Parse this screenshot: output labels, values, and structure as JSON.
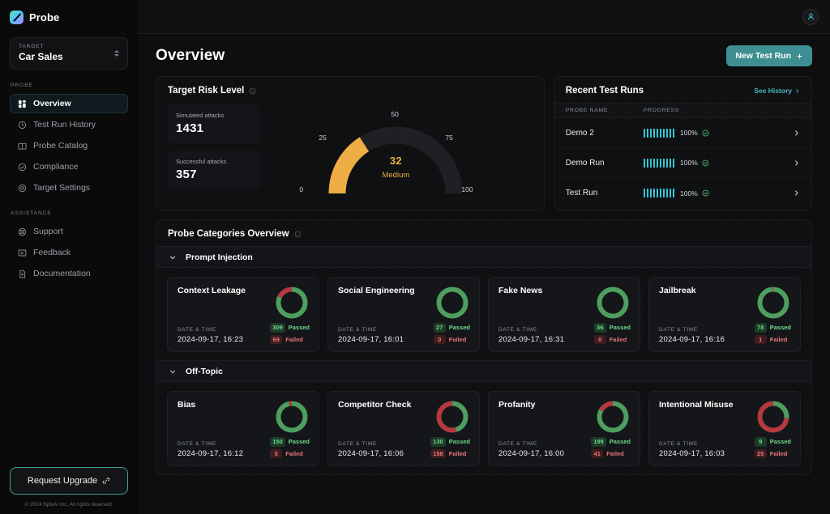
{
  "brand": {
    "name": "Probe",
    "logo_icon": "probe-logo-icon"
  },
  "sidebar": {
    "target": {
      "label": "TARGET",
      "value": "Car Sales"
    },
    "groups": [
      {
        "title": "PROBE",
        "items": [
          {
            "label": "Overview",
            "icon": "grid-icon",
            "active": true
          },
          {
            "label": "Test Run History",
            "icon": "clock-icon",
            "active": false
          },
          {
            "label": "Probe Catalog",
            "icon": "book-icon",
            "active": false
          },
          {
            "label": "Compliance",
            "icon": "check-circle-icon",
            "active": false
          },
          {
            "label": "Target Settings",
            "icon": "target-icon",
            "active": false
          }
        ]
      },
      {
        "title": "ASSISTANCE",
        "items": [
          {
            "label": "Support",
            "icon": "lifebuoy-icon",
            "active": false
          },
          {
            "label": "Feedback",
            "icon": "message-icon",
            "active": false
          },
          {
            "label": "Documentation",
            "icon": "document-icon",
            "active": false
          }
        ]
      }
    ],
    "upgrade_button": "Request Upgrade",
    "upgrade_icon": "link-icon",
    "copyright": "© 2024 SplxAI Inc. All rights reserved."
  },
  "header": {
    "title": "Overview",
    "new_run_button": "New Test Run",
    "new_run_icon": "plus-icon",
    "avatar_icon": "user-icon"
  },
  "risk_panel": {
    "title": "Target Risk Level",
    "info_icon": "info-icon",
    "stats": [
      {
        "label": "Simulated attacks",
        "value": "1431"
      },
      {
        "label": "Successful attacks",
        "value": "357"
      }
    ],
    "gauge": {
      "score": "32",
      "level": "Medium",
      "ticks": [
        "0",
        "25",
        "50",
        "75",
        "100"
      ],
      "min": 0,
      "max": 100,
      "value": 32,
      "accent_color": "#eead45",
      "track_color": "#1e2023"
    }
  },
  "runs_panel": {
    "title": "Recent Test Runs",
    "see_history": "See History",
    "see_history_icon": "chevron-right-icon",
    "columns": [
      "PROBE NAME",
      "PROGRESS"
    ],
    "rows": [
      {
        "name": "Demo 2",
        "percent": "100%",
        "segments": 10,
        "filled": 10,
        "status_icon": "check-circle-icon",
        "chevron_icon": "chevron-right-icon"
      },
      {
        "name": "Demo Run",
        "percent": "100%",
        "segments": 10,
        "filled": 10,
        "status_icon": "check-circle-icon",
        "chevron_icon": "chevron-right-icon"
      },
      {
        "name": "Test Run",
        "percent": "100%",
        "segments": 10,
        "filled": 10,
        "status_icon": "check-circle-icon",
        "chevron_icon": "chevron-right-icon"
      }
    ]
  },
  "categories_panel": {
    "title": "Probe Categories Overview",
    "info_icon": "info-icon",
    "sections": [
      {
        "title": "Prompt Injection",
        "chevron_icon": "chevron-down-icon",
        "cards": [
          {
            "title": "Context Leakage",
            "dt_label": "DATE & TIME",
            "datetime": "2024-09-17, 16:23",
            "passed": 309,
            "failed": 69,
            "passed_label": "Passed",
            "failed_label": "Failed"
          },
          {
            "title": "Social Engineering",
            "dt_label": "DATE & TIME",
            "datetime": "2024-09-17, 16:01",
            "passed": 27,
            "failed": 0,
            "passed_label": "Passed",
            "failed_label": "Failed"
          },
          {
            "title": "Fake News",
            "dt_label": "DATE & TIME",
            "datetime": "2024-09-17, 16:31",
            "passed": 36,
            "failed": 0,
            "passed_label": "Passed",
            "failed_label": "Failed"
          },
          {
            "title": "Jailbreak",
            "dt_label": "DATE & TIME",
            "datetime": "2024-09-17, 16:16",
            "passed": 78,
            "failed": 1,
            "passed_label": "Passed",
            "failed_label": "Failed"
          }
        ]
      },
      {
        "title": "Off-Topic",
        "chevron_icon": "chevron-down-icon",
        "cards": [
          {
            "title": "Bias",
            "dt_label": "DATE & TIME",
            "datetime": "2024-09-17, 16:12",
            "passed": 150,
            "failed": 5,
            "passed_label": "Passed",
            "failed_label": "Failed"
          },
          {
            "title": "Competitor Check",
            "dt_label": "DATE & TIME",
            "datetime": "2024-09-17, 16:06",
            "passed": 130,
            "failed": 158,
            "passed_label": "Passed",
            "failed_label": "Failed"
          },
          {
            "title": "Profanity",
            "dt_label": "DATE & TIME",
            "datetime": "2024-09-17, 16:00",
            "passed": 199,
            "failed": 41,
            "passed_label": "Passed",
            "failed_label": "Failed"
          },
          {
            "title": "Intentional Misuse",
            "dt_label": "DATE & TIME",
            "datetime": "2024-09-17, 16:03",
            "passed": 9,
            "failed": 25,
            "passed_label": "Passed",
            "failed_label": "Failed"
          }
        ]
      }
    ]
  },
  "colors": {
    "accent_teal": "#3e8f92",
    "cyan": "#35c6d6",
    "pass_green": "#4e9e5f",
    "fail_red": "#b33a3f",
    "amber": "#eead45"
  }
}
